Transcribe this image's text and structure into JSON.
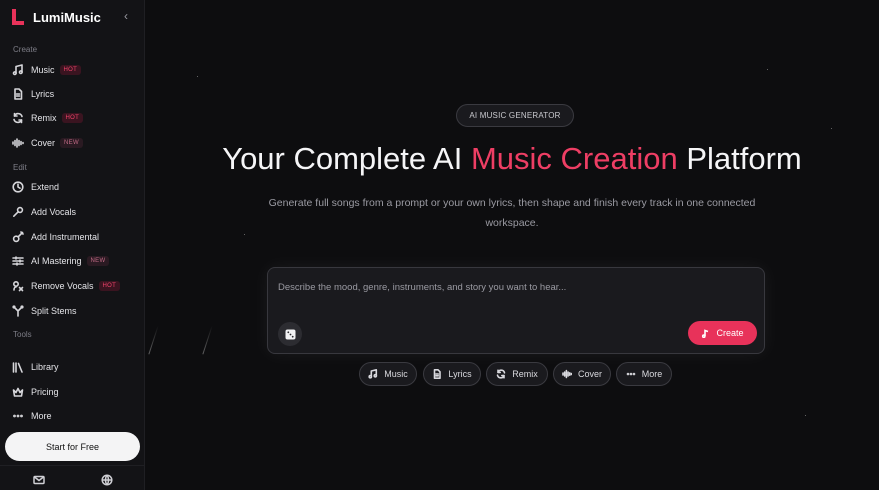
{
  "brand": {
    "name": "LumiMusic"
  },
  "sidebar": {
    "sections": {
      "create": "Create",
      "edit": "Edit",
      "tools": "Tools"
    },
    "items": [
      {
        "id": "music",
        "label": "Music",
        "icon": "music-note-icon",
        "badge": "HOT"
      },
      {
        "id": "lyrics",
        "label": "Lyrics",
        "icon": "document-icon",
        "badge": ""
      },
      {
        "id": "remix",
        "label": "Remix",
        "icon": "refresh-icon",
        "badge": "HOT"
      },
      {
        "id": "cover",
        "label": "Cover",
        "icon": "waveform-icon",
        "badge": "NEW"
      },
      {
        "id": "extend",
        "label": "Extend",
        "icon": "clock-icon",
        "badge": ""
      },
      {
        "id": "add-vocals",
        "label": "Add Vocals",
        "icon": "microphone-icon",
        "badge": ""
      },
      {
        "id": "add-instrumental",
        "label": "Add Instrumental",
        "icon": "guitar-icon",
        "badge": ""
      },
      {
        "id": "ai-mastering",
        "label": "AI Mastering",
        "icon": "sliders-icon",
        "badge": "NEW"
      },
      {
        "id": "remove-vocals",
        "label": "Remove Vocals",
        "icon": "mic-remove-icon",
        "badge": "HOT"
      },
      {
        "id": "split-stems",
        "label": "Split Stems",
        "icon": "split-icon",
        "badge": ""
      },
      {
        "id": "library",
        "label": "Library",
        "icon": "library-icon",
        "badge": ""
      },
      {
        "id": "pricing",
        "label": "Pricing",
        "icon": "crown-icon",
        "badge": ""
      },
      {
        "id": "more",
        "label": "More",
        "icon": "ellipsis-icon",
        "badge": ""
      }
    ],
    "start_button": "Start for Free",
    "footer_icons": [
      "mail-icon",
      "globe-icon"
    ]
  },
  "hero": {
    "pill": "AI MUSIC GENERATOR",
    "headline_pre": "Your Complete AI ",
    "headline_accent": "Music Creation",
    "headline_post": " Platform",
    "subtitle": "Generate full songs from a prompt or your own lyrics, then shape and finish every track in one connected workspace."
  },
  "prompt": {
    "value": "",
    "placeholder": "Describe the mood, genre, instruments, and story you want to hear...",
    "create_label": "Create"
  },
  "chips": [
    {
      "label": "Music",
      "icon": "music-note-icon"
    },
    {
      "label": "Lyrics",
      "icon": "document-icon"
    },
    {
      "label": "Remix",
      "icon": "refresh-icon"
    },
    {
      "label": "Cover",
      "icon": "waveform-icon"
    },
    {
      "label": "More",
      "icon": "ellipsis-icon"
    }
  ],
  "colors": {
    "accent": "#e8325a",
    "background": "#0d0d0f",
    "sidebar": "#131316"
  }
}
